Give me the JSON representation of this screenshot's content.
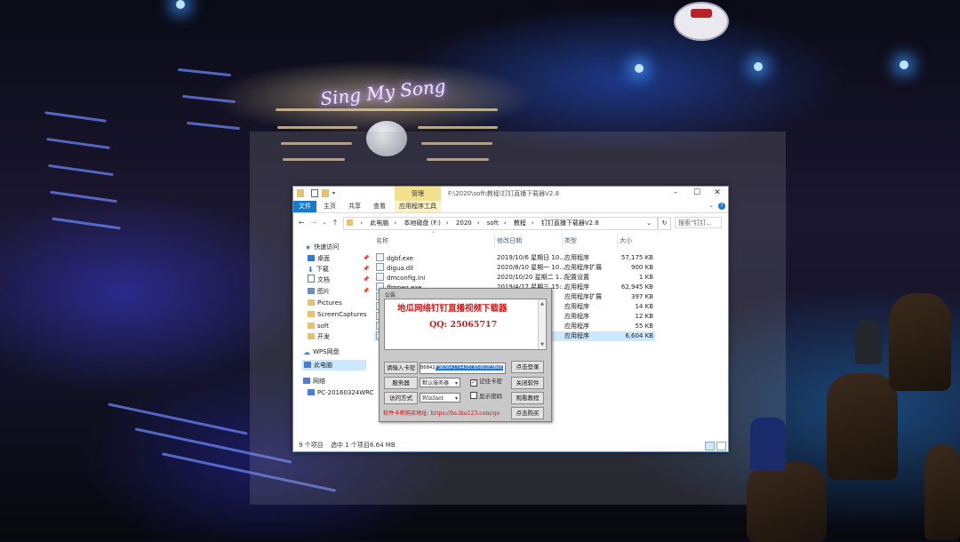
{
  "explorer": {
    "manage_label": "管理",
    "path_title": "F:\\2020\\soft\\教程\\钉钉直播下载器V2.8",
    "tabs": [
      "文件",
      "主页",
      "共享",
      "查看",
      "应用程序工具"
    ],
    "breadcrumb": [
      "此电脑",
      "本地磁盘 (F:)",
      "2020",
      "soft",
      "教程",
      "钉钉直播下载器V2.8"
    ],
    "search_placeholder": "搜索\"钉钉...",
    "nav": [
      {
        "label": "快速访问",
        "icon": "star-icon"
      },
      {
        "label": "桌面",
        "icon": "desktop-icon",
        "pinned": true
      },
      {
        "label": "下载",
        "icon": "download-icon",
        "pinned": true
      },
      {
        "label": "文档",
        "icon": "document-icon",
        "pinned": true
      },
      {
        "label": "图片",
        "icon": "picture-icon",
        "pinned": true
      },
      {
        "label": "Pictures",
        "icon": "folder-icon"
      },
      {
        "label": "ScreenCaptures",
        "icon": "folder-icon"
      },
      {
        "label": "soft",
        "icon": "folder-icon"
      },
      {
        "label": "开发",
        "icon": "folder-icon"
      },
      {
        "label": "WPS网盘",
        "icon": "cloud-icon"
      },
      {
        "label": "此电脑",
        "icon": "computer-icon",
        "selected": true
      },
      {
        "label": "网络",
        "icon": "network-icon"
      },
      {
        "label": "PC-20160324WRC",
        "icon": "computer-icon"
      }
    ],
    "columns": {
      "name": "名称",
      "date": "修改日期",
      "type": "类型",
      "size": "大小"
    },
    "files": [
      {
        "name": "dgbf.exe",
        "date": "2019/10/6 星期日 10...",
        "type": "应用程序",
        "size": "57,175 KB"
      },
      {
        "name": "digua.dll",
        "date": "2020/8/10 星期一 10...",
        "type": "应用程序扩展",
        "size": "900 KB"
      },
      {
        "name": "dmconfig.ini",
        "date": "2020/10/20 星期二 1...",
        "type": "配置设置",
        "size": "1 KB"
      },
      {
        "name": "ffmpeg.exe",
        "date": "2019/4/17 星期三 15:...",
        "type": "应用程序",
        "size": "62,945 KB"
      },
      {
        "name": "",
        "date": "",
        "type": "应用程序扩展",
        "size": "397 KB"
      },
      {
        "name": "",
        "date": "",
        "type": "应用程序",
        "size": "14 KB"
      },
      {
        "name": "",
        "date": "",
        "type": "应用程序",
        "size": "12 KB"
      },
      {
        "name": "",
        "date": "37",
        "type": "应用程序",
        "size": "55 KB"
      },
      {
        "name": "",
        "date": "",
        "type": "应用程序",
        "size": "6,604 KB",
        "selected": true
      }
    ],
    "status": {
      "count": "9 个项目",
      "selected": "选中 1 个项目",
      "size": "6.64 MB"
    }
  },
  "dialog": {
    "notice_label": "公告",
    "title": "地瓜网络钉钉直播视频下载器",
    "qq": "QQ: 25065717",
    "card_label": "请输入卡密",
    "card_value": "B6B42",
    "card_value_selected": "F3B30A17A42EC850D2E3B6E",
    "login_button": "点击登录",
    "server_label": "服务器",
    "server_value": "默认服务器",
    "remember_label": "记住卡密",
    "remember_checked": true,
    "close_button": "关闭软件",
    "access_label": "访问方式",
    "access_value": "WinInet",
    "show_pwd_label": "显示密码",
    "show_pwd_checked": false,
    "tutorial_button": "观看教程",
    "footer_text": "软件卡密购买地址:",
    "footer_url": "https://bs.lka123.com/go",
    "buy_button": "点击购买"
  },
  "background": {
    "sign_text": "Sing My Song"
  }
}
